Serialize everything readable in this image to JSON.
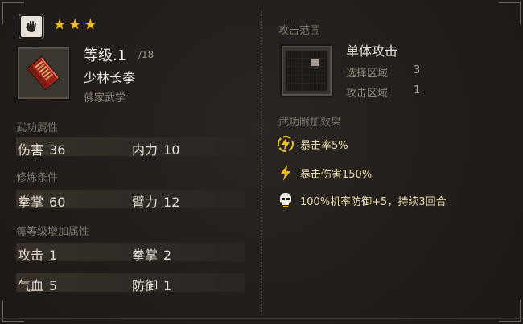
{
  "header": {
    "type_icon": "hand-palm-icon",
    "stars": [
      "★",
      "★",
      "★"
    ],
    "star_color": "#f0c020"
  },
  "skill": {
    "icon": "red-book-icon",
    "level": "等级.1",
    "max_level": "/18",
    "name": "少林长拳",
    "school": "佛家武学"
  },
  "sections": {
    "attributes_title": "武功属性",
    "requirements_title": "修炼条件",
    "per_level_title": "每等级增加属性"
  },
  "attributes": [
    {
      "label": "伤害",
      "value": "36"
    },
    {
      "label": "内力",
      "value": "10"
    }
  ],
  "requirements": [
    {
      "label": "拳掌",
      "value": "60"
    },
    {
      "label": "臂力",
      "value": "12"
    }
  ],
  "per_level": [
    {
      "label": "攻击",
      "value": "1"
    },
    {
      "label": "拳掌",
      "value": "2"
    },
    {
      "label": "气血",
      "value": "5"
    },
    {
      "label": "防御",
      "value": "1"
    }
  ],
  "range": {
    "title": "攻击范围",
    "type": "单体攻击",
    "select_label": "选择区域",
    "select_value": "3",
    "attack_label": "攻击区域",
    "attack_value": "1"
  },
  "effects": {
    "title": "武功附加效果",
    "items": [
      {
        "icon": "lightning-circle-icon",
        "text": "暴击率5%"
      },
      {
        "icon": "lightning-icon",
        "text": "暴击伤害150%"
      },
      {
        "icon": "skull-icon",
        "text": "100%机率防御+5，持续3回合"
      }
    ]
  },
  "colors": {
    "background": "#201c19",
    "effect_text": "#eadfb0",
    "icon_gold": "#f0c020"
  }
}
